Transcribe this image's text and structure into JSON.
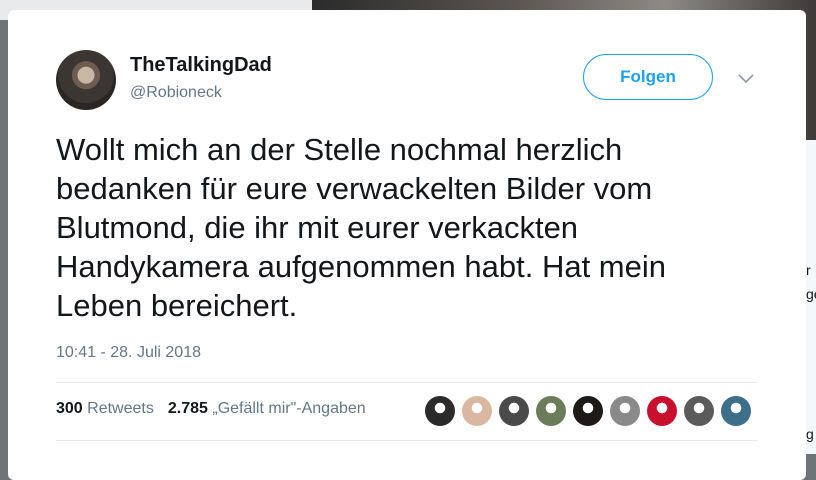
{
  "tweet": {
    "user": {
      "name": "TheTalkingDad",
      "handle": "@Robioneck"
    },
    "follow_label": "Folgen",
    "text_lines": [
      "Wollt mich an der Stelle nochmal herzlich",
      "bedanken für eure verwackelten Bilder vom",
      "Blutmond, die ihr mit eurer verkackten",
      "Handykamera aufgenommen habt. Hat mein",
      "Leben bereichert."
    ],
    "timestamp": "10:41 - 28. Juli 2018",
    "stats": {
      "retweets_count": "300",
      "retweets_label": "Retweets",
      "likes_count": "2.785",
      "likes_label": "„Gefällt mir\"-Angaben"
    },
    "liker_avatars": [
      {
        "name": "liker-avatar-1",
        "color": "#2b2b2b"
      },
      {
        "name": "liker-avatar-2",
        "color": "#d9b7a0"
      },
      {
        "name": "liker-avatar-3",
        "color": "#4a4a4a"
      },
      {
        "name": "liker-avatar-4",
        "color": "#6b7c5a"
      },
      {
        "name": "liker-avatar-5",
        "color": "#1e1a18"
      },
      {
        "name": "liker-avatar-6",
        "color": "#8a8a8a"
      },
      {
        "name": "liker-avatar-7",
        "color": "#c8102e"
      },
      {
        "name": "liker-avatar-8",
        "color": "#5b5b5b"
      },
      {
        "name": "liker-avatar-9",
        "color": "#3d6f8a"
      }
    ]
  },
  "background": {
    "right_edge_letters": [
      "r",
      "ge",
      "g"
    ]
  },
  "colors": {
    "accent": "#1da1f2",
    "text_primary": "#14171a",
    "text_secondary": "#657786"
  }
}
